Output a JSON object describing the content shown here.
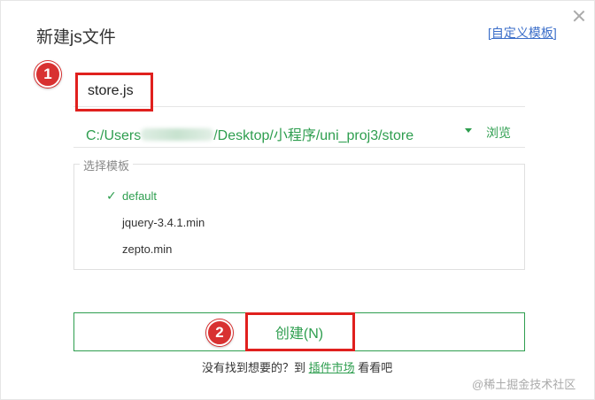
{
  "dialog": {
    "title": "新建js文件",
    "close_icon": "close-icon",
    "custom_template_open": "[",
    "custom_template_label": "自定义模板",
    "custom_template_close": "]"
  },
  "markers": [
    "1",
    "2"
  ],
  "filename": {
    "value": "store.js"
  },
  "path": {
    "prefix": "C:/Users",
    "suffix": "/Desktop/小程序/uni_proj3/store",
    "browse_label": "浏览",
    "dropdown_icon": "caret-down-icon"
  },
  "templates": {
    "legend": "选择模板",
    "items": [
      {
        "label": "default",
        "selected": true
      },
      {
        "label": "jquery-3.4.1.min",
        "selected": false
      },
      {
        "label": "zepto.min",
        "selected": false
      }
    ],
    "check_glyph": "✓"
  },
  "create_button": {
    "label": "创建(N)"
  },
  "hint": {
    "before": "没有找到想要的？到 ",
    "link": "插件市场",
    "after": " 看看吧"
  },
  "watermark": "@稀土掘金技术社区",
  "colors": {
    "accent": "#2e9e4f",
    "marker": "#d83131",
    "link": "#3b6ec9"
  }
}
